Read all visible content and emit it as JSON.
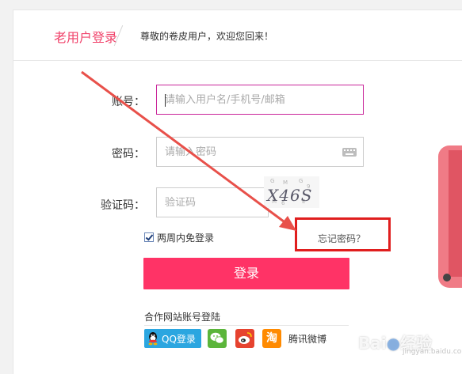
{
  "header": {
    "title": "老用户登录",
    "subtitle": "尊敬的卷皮用户，欢迎您回来！"
  },
  "form": {
    "account_label": "账号：",
    "account_placeholder": "请输入用户名/手机号/邮箱",
    "password_label": "密码：",
    "password_placeholder": "请输入密码",
    "captcha_label": "验证码：",
    "captcha_placeholder": "验证码",
    "captcha_text": "X46S",
    "remember_label": "两周内免登录",
    "remember_checked": true,
    "forgot_label": "忘记密码？",
    "login_label": "登录"
  },
  "partners": {
    "title": "合作网站账号登陆",
    "qq_label": "QQ登录",
    "taobao_glyph": "淘",
    "tencent_weibo_label": "腾讯微博"
  },
  "icons": {
    "keyboard": "keyboard-icon",
    "qq": "qq-icon",
    "wechat": "wechat-icon",
    "weibo": "weibo-icon",
    "taobao": "taobao-icon"
  },
  "colors": {
    "accent": "#ff3366",
    "title": "#f0426a",
    "annotation": "#e01e1e"
  }
}
